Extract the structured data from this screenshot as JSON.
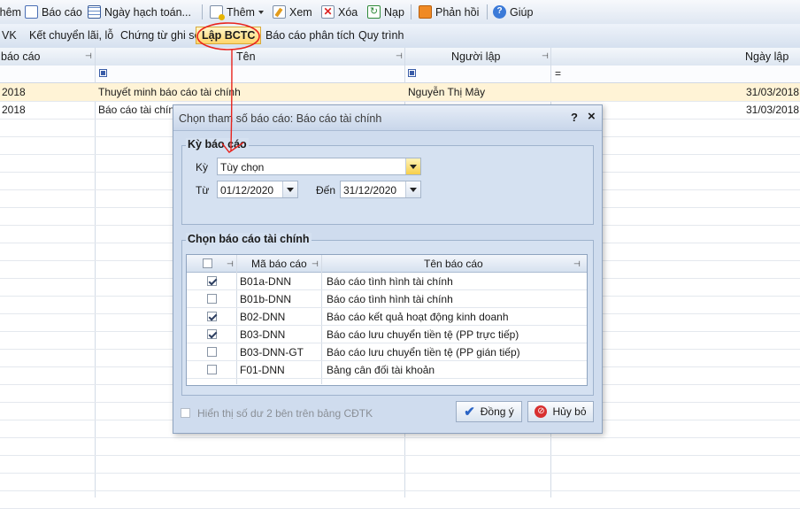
{
  "toolbar": {
    "items": [
      {
        "label": "Thêm",
        "icon": "add-icon"
      },
      {
        "label": "Báo cáo",
        "icon": "report-icon"
      },
      {
        "label": "Ngày hạch toán...",
        "icon": "calendar-icon"
      },
      {
        "label": "Thêm",
        "icon": "add-page-icon"
      },
      {
        "label": "Xem",
        "icon": "view-edit-icon"
      },
      {
        "label": "Xóa",
        "icon": "delete-icon"
      },
      {
        "label": "Nạp",
        "icon": "refresh-icon"
      },
      {
        "label": "Phản hồi",
        "icon": "mail-icon"
      },
      {
        "label": "Giúp",
        "icon": "help-icon"
      }
    ]
  },
  "tabs": [
    "VK",
    "Kết chuyển lãi, lỗ",
    "Chứng từ ghi sổ",
    "Lập BCTC",
    "Báo cáo phân tích",
    "Quy trình"
  ],
  "grid": {
    "headers": {
      "col1": "báo cáo",
      "col2": "Tên",
      "col3": "Người lập",
      "col4": "Ngày lập"
    },
    "filter_eq": "=",
    "rows": [
      {
        "c1": "2018",
        "c2": "Thuyết minh báo cáo tài chính",
        "c3": "Nguyễn Thị Mây",
        "c4": "31/03/2018"
      },
      {
        "c1": "2018",
        "c2": "Báo cáo tài chính",
        "c3": "",
        "c4": "31/03/2018"
      }
    ]
  },
  "dialog": {
    "title": "Chọn tham số báo cáo: Báo cáo tài chính",
    "help": "?",
    "close": "×",
    "period_group": "Kỳ báo cáo",
    "ky_label": "Kỳ",
    "ky_value": "Tùy chọn",
    "tu_label": "Từ",
    "tu_value": "01/12/2020",
    "den_label": "Đến",
    "den_value": "31/12/2020",
    "report_group": "Chọn báo cáo tài chính",
    "col_code": "Mã báo cáo",
    "col_name": "Tên báo cáo",
    "reports": [
      {
        "code": "B01a-DNN",
        "name": "Báo cáo tình hình tài chính",
        "checked": true
      },
      {
        "code": "B01b-DNN",
        "name": "Báo cáo tình hình tài chính",
        "checked": false
      },
      {
        "code": "B02-DNN",
        "name": "Báo cáo kết quả hoạt động kinh doanh",
        "checked": true
      },
      {
        "code": "B03-DNN",
        "name": "Báo cáo lưu chuyển tiền tệ (PP trực tiếp)",
        "checked": true
      },
      {
        "code": "B03-DNN-GT",
        "name": "Báo cáo lưu chuyển tiền tệ (PP gián tiếp)",
        "checked": false
      },
      {
        "code": "F01-DNN",
        "name": "Bảng cân đối tài khoản",
        "checked": false
      }
    ],
    "show_balance_label": "Hiển thị số dư 2 bên trên bảng CĐTK",
    "ok_label": "Đồng ý",
    "cancel_label": "Hủy bỏ"
  },
  "colors": {
    "annotation": "#e8231d",
    "highlight": "#fff3d6",
    "tab_active": "#ffd56b"
  }
}
